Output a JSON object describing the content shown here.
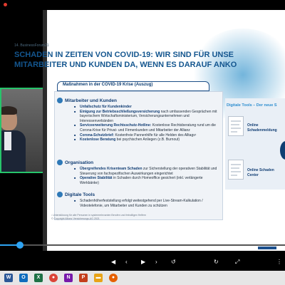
{
  "slide": {
    "event_label": "14. BusinessForum21",
    "title_line1": "SCHADEN IN ZEITEN VON COVID-19: WIR SIND FÜR UNSE",
    "title_line2": "MITARBEITER UND KUNDEN DA, WENN ES DARAUF ANKO",
    "measures_header": "Maßnahmen in der COVID-19 Krise (Auszug)",
    "sections": {
      "staff": {
        "heading": "Mitarbeiter und Kunden",
        "items": [
          {
            "bold": "Unfallschutz für Kundenkinder",
            "rest": ""
          },
          {
            "bold": "Einigung zur Betriebsschließungsversicherung",
            "rest": " nach umfassenden Gesprächen mit bayerischem Wirtschaftsministerium, Versicherungsunternehmen und Interessenverbänden"
          },
          {
            "bold": "Serviceerweiterung Rechtsschutz-Hotline:",
            "rest": " Kostenlose Rechtsberatung rund um die Corona-Krise für Privat- und Firmenkunden und Mitarbeiter der Allianz"
          },
          {
            "bold": "Corona-Schutzbrief:",
            "rest": " Kostenfreie Pannenhilfe für alle Helden des Alltags¹"
          },
          {
            "bold": "Kostenlose Beratung",
            "rest": " bei psychischen Anliegen (z.B. Burnout)"
          }
        ]
      },
      "organisation": {
        "heading": "Organisation",
        "items": [
          {
            "bold": "Übergreifendes Krisenteam Schaden",
            "rest": " zur Sicherstellung der operativen Stabilität und Steuerung von fachspezifischen Auswirkungen eingerichtet"
          },
          {
            "bold": "Operative Stabilität",
            "rest": " in Schaden durch Homeoffice gesichert (inkl. verlängerte Werkbänke)"
          }
        ]
      },
      "digital": {
        "heading": "Digitale Tools",
        "items": [
          {
            "bold": "",
            "rest": "Schadenhöherfeststellung erfolgt weitestgehend per Live-Stream-Kalkulation / Videotelefonie, um Mitarbeiter und Kunden zu schützen"
          }
        ]
      }
    },
    "digital_tools_panel": {
      "title": "Digitale Tools – Der neue S",
      "tool1_line1": "Online",
      "tool1_line2": "Schadenmeldung",
      "tool2_line1": "Online Schaden",
      "tool2_line2": "Center"
    },
    "footnote_line1": "¹ Unterstützung für alle Personen in systemrelevanten Berufen und freiwilligen Helfern",
    "footnote_line2": "© Copyright Allianz Versicherungs-AG 2021"
  },
  "player": {
    "controls": {
      "prev_symbol": "◀",
      "next_symbol": "▶",
      "slide_prev_symbol": "‹",
      "slide_next_symbol": "›",
      "skip_back_symbol": "↺",
      "skip_fwd_symbol": "↻",
      "fullscreen_symbol": "⤢",
      "menu_symbol": "⋮"
    },
    "progress_fraction": 0.07
  },
  "taskbar": {
    "icons": [
      {
        "name": "word",
        "glyph": "W",
        "color": "#2b5797"
      },
      {
        "name": "outlook",
        "glyph": "O",
        "color": "#0f6cbd"
      },
      {
        "name": "excel",
        "glyph": "X",
        "color": "#1e7145"
      },
      {
        "name": "chrome",
        "glyph": "●",
        "color": "#db4437"
      },
      {
        "name": "onenote",
        "glyph": "N",
        "color": "#7719aa"
      },
      {
        "name": "powerpoint",
        "glyph": "P",
        "color": "#c43e1c"
      },
      {
        "name": "explorer",
        "glyph": "▬",
        "color": "#e8a317"
      },
      {
        "name": "firefox",
        "glyph": "●",
        "color": "#e66000"
      }
    ]
  },
  "colors": {
    "accent": "#2ea3f2",
    "slide_title": "#14568f",
    "camera_border": "#27c46b"
  }
}
